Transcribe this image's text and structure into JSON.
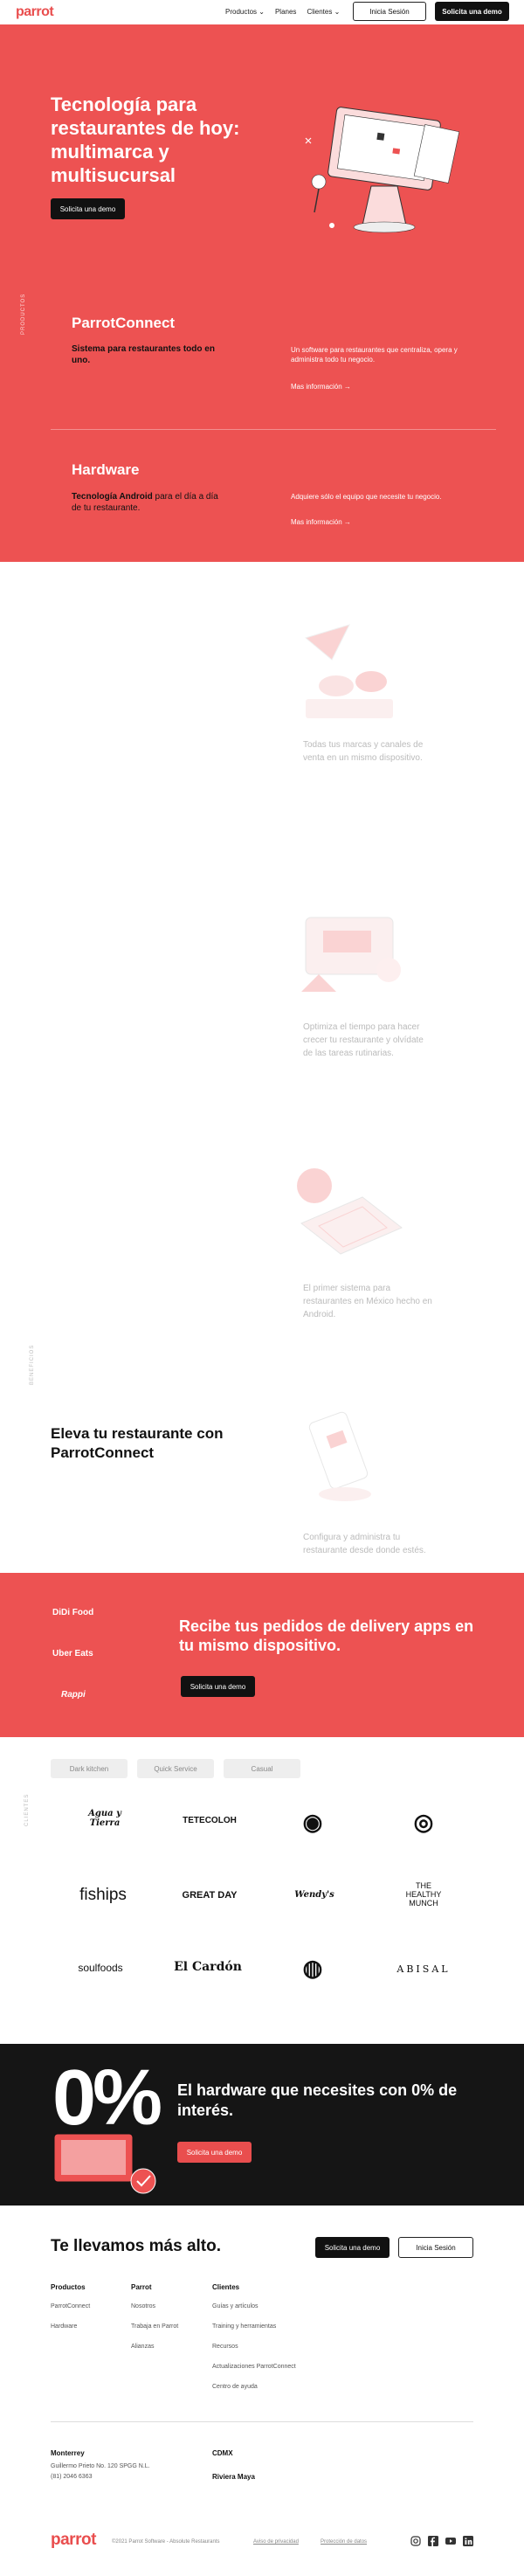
{
  "header": {
    "logo": "parrot",
    "nav": [
      {
        "label": "Productos",
        "chevron": "⌄"
      },
      {
        "label": "Planes",
        "chevron": ""
      },
      {
        "label": "Clientes",
        "chevron": "⌄"
      }
    ],
    "login_label": "Inicia Sesión",
    "demo_label": "Solicita una demo"
  },
  "hero": {
    "title": "Tecnología para restaurantes de hoy: multimarca y multisucursal",
    "cta_label": "Solicita una demo",
    "side_label": "PRODUCTOS",
    "accent": "#ed5252"
  },
  "products": [
    {
      "name": "ParrotConnect",
      "desc": "Sistema para restaurantes todo en uno.",
      "desc_normal": "",
      "right_text": "Un software para restaurantes que centraliza, opera y administra todo tu negocio.",
      "link": "Mas información  →"
    },
    {
      "name": "Hardware",
      "desc": "Tecnología Android",
      "desc_normal": " para el día a día de tu restaurante.",
      "right_text": "Adquiere sólo el equipo que necesite tu negocio.",
      "link": "Mas información  →"
    }
  ],
  "features": {
    "side_label": "BENEFICIOS",
    "items": [
      "Todas tus marcas y canales de venta en un mismo dispositivo.",
      "Optimiza el tiempo para hacer crecer tu restaurante y olvídate de las tareas rutinarias.",
      "El primer sistema para restaurantes en México hecho en Android.",
      "Configura y administra tu restaurante desde donde estés."
    ],
    "eleva_title": "Eleva tu restaurante con ParrotConnect"
  },
  "delivery": {
    "logos": [
      "DiDi Food",
      "Uber Eats",
      "Rappi"
    ],
    "title": "Recibe tus pedidos de delivery apps en tu mismo dispositivo.",
    "cta_label": "Solicita una demo"
  },
  "clients": {
    "side_label": "CLIENTES",
    "tabs": [
      "Dark kitchen",
      "Quick Service",
      "Casual"
    ],
    "logos": [
      "Agua y Tierra",
      "TETECOLOH",
      "◉",
      "◎",
      "fiships",
      "GREAT DAY",
      "Wendy's",
      "THE HEALTHY MUNCH",
      "soulfoods",
      "El Cardón",
      "◍",
      "ABISAL"
    ]
  },
  "hardware_banner": {
    "big": "0%",
    "title": "El hardware que necesites con 0% de interés.",
    "cta_label": "Solicita una demo"
  },
  "footer": {
    "title": "Te llevamos más alto.",
    "demo_label": "Solicita una demo",
    "login_label": "Inicia Sesión",
    "columns": [
      {
        "head": "Productos",
        "items": [
          "ParrotConnect",
          "Hardware"
        ]
      },
      {
        "head": "Parrot",
        "items": [
          "Nosotros",
          "Trabaja en Parrot",
          "Alianzas"
        ]
      },
      {
        "head": "Clientes",
        "items": [
          "Guías y artículos",
          "Training y herramientas",
          "Recursos",
          "Actualizaciones ParrotConnect",
          "Centro de ayuda"
        ]
      }
    ],
    "offices": [
      {
        "city": "Monterrey",
        "lines": [
          "Guillermo Prieto No. 120 SPGG N.L.",
          "(81) 2046 6363"
        ]
      },
      {
        "city": "CDMX",
        "lines": []
      },
      {
        "city": "Riviera Maya",
        "lines": []
      }
    ],
    "logo": "parrot",
    "copyright": "©2021 Parrot Software - Absolute Restaurants",
    "privacy": "Aviso de privacidad",
    "protect": "Protección de datos",
    "socials": [
      "instagram-icon",
      "facebook-icon",
      "youtube-icon",
      "linkedin-icon"
    ]
  }
}
